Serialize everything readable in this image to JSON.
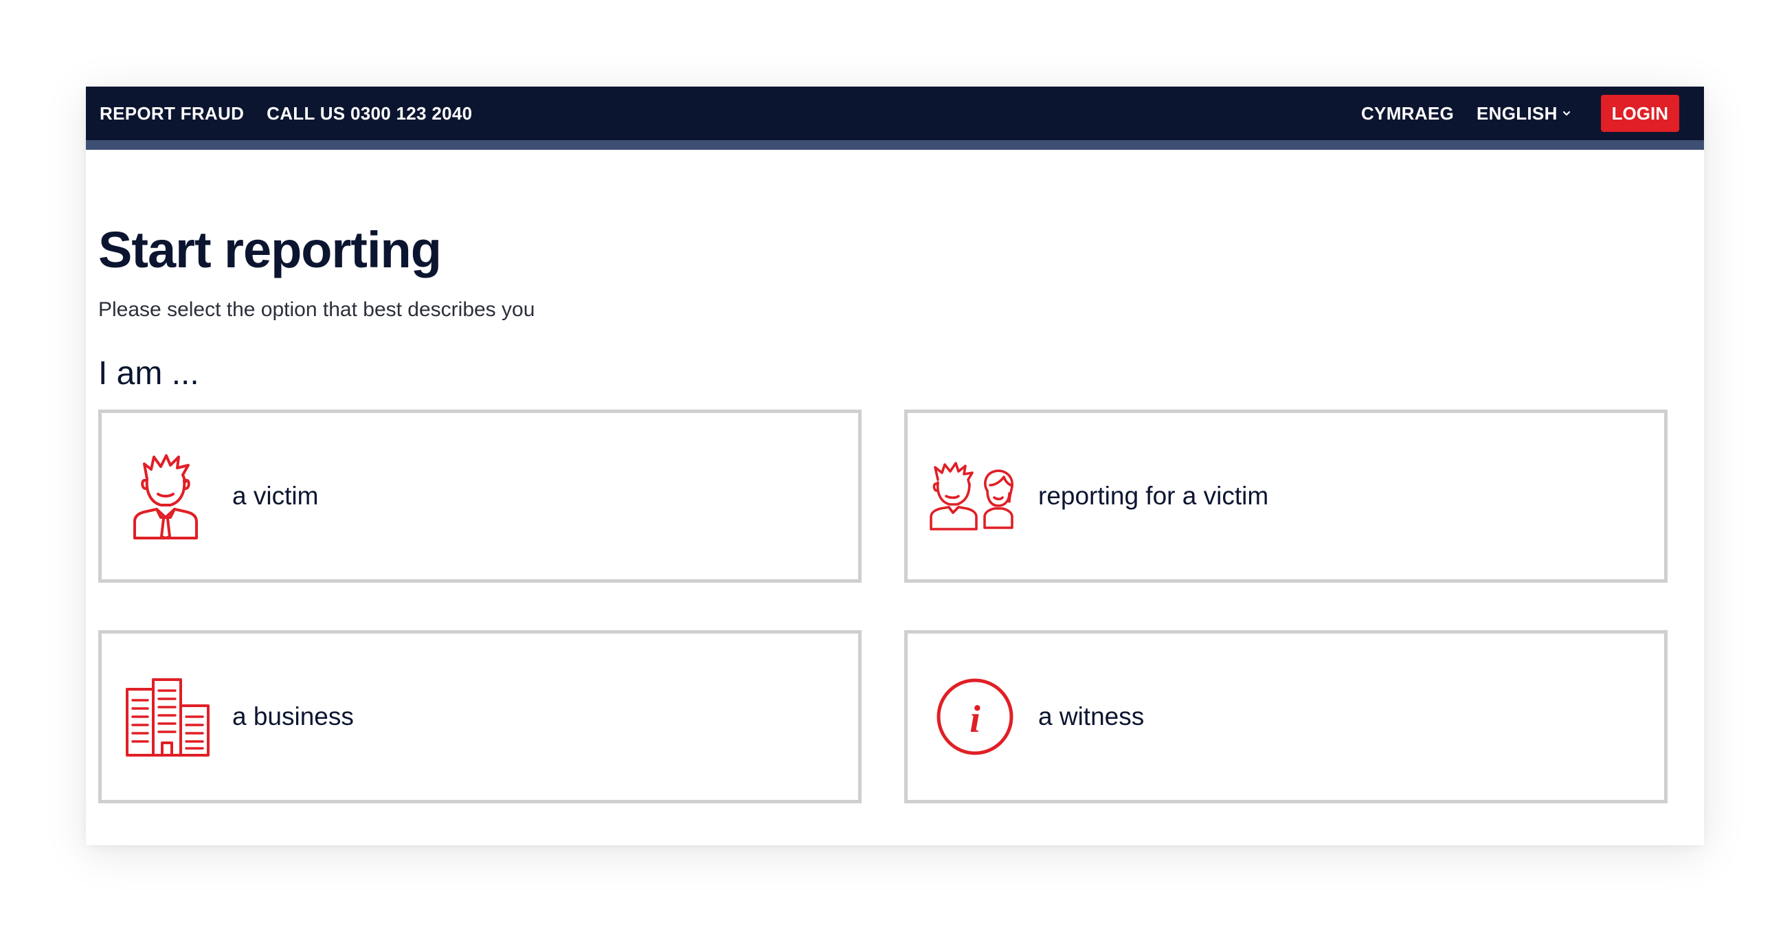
{
  "topbar": {
    "report_fraud": "REPORT FRAUD",
    "call_us": "CALL US 0300 123 2040",
    "cymraeg": "CYMRAEG",
    "language": "ENGLISH",
    "login": "LOGIN"
  },
  "page": {
    "title": "Start reporting",
    "subtitle": "Please select the option that best describes you",
    "prompt": "I am ..."
  },
  "options": [
    {
      "label": "a victim",
      "icon": "victim-person-icon"
    },
    {
      "label": "reporting for a victim",
      "icon": "two-people-icon"
    },
    {
      "label": "a business",
      "icon": "office-buildings-icon"
    },
    {
      "label": "a witness",
      "icon": "information-circle-icon"
    }
  ],
  "colors": {
    "navy": "#0c1530",
    "stripe": "#3f4f74",
    "accent_red": "#e01f26",
    "card_border": "#cfcfcf"
  }
}
